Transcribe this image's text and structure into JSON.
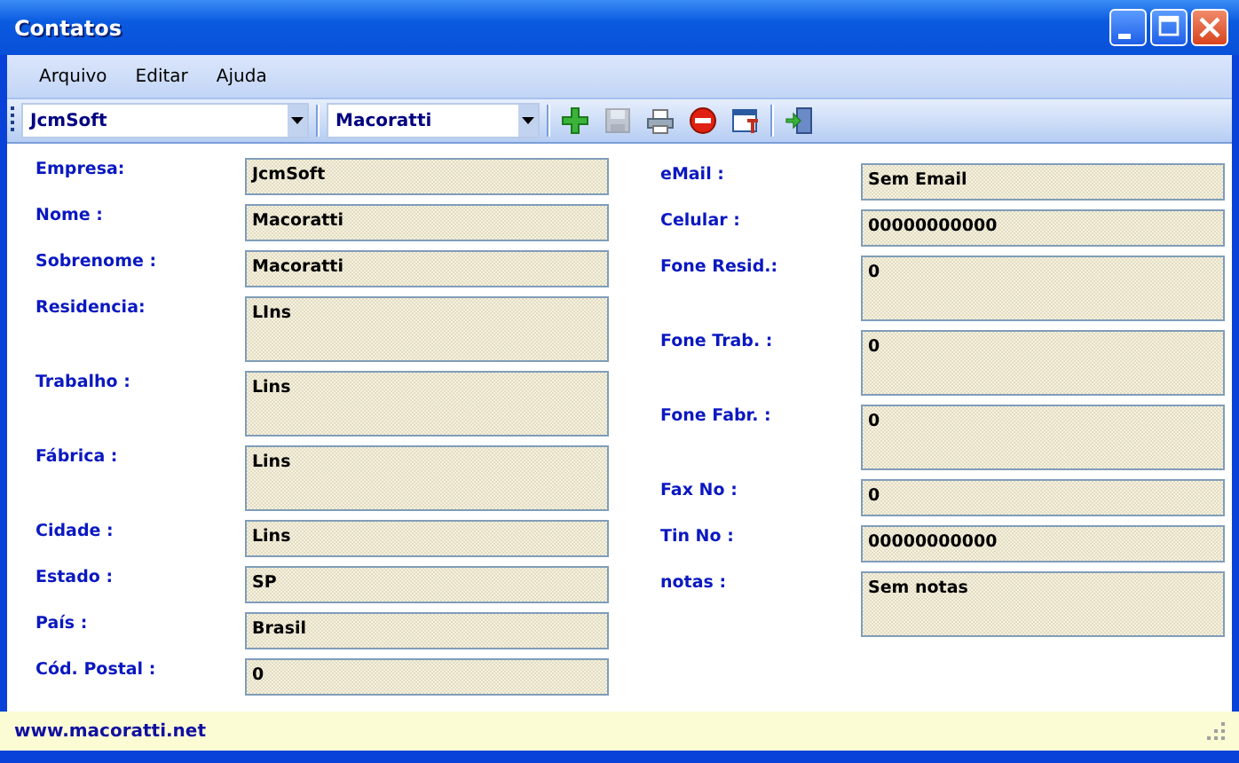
{
  "window": {
    "title": "Contatos"
  },
  "menu": [
    "Arquivo",
    "Editar",
    "Ajuda"
  ],
  "toolbar": {
    "combos": [
      {
        "value": "JcmSoft"
      },
      {
        "value": "Macoratti"
      }
    ],
    "buttons": [
      {
        "kind": "add",
        "disabled": false
      },
      {
        "kind": "save",
        "disabled": true
      },
      {
        "kind": "print",
        "disabled": false
      },
      {
        "kind": "delete",
        "disabled": false
      },
      {
        "kind": "edit",
        "disabled": false
      },
      {
        "kind": "exit",
        "disabled": false
      }
    ]
  },
  "form": {
    "left": [
      {
        "label": "Empresa:",
        "value": "JcmSoft",
        "kind": "single"
      },
      {
        "label": "Nome :",
        "value": "Macoratti",
        "kind": "single"
      },
      {
        "label": "Sobrenome :",
        "value": "Macoratti",
        "kind": "single"
      },
      {
        "label": "Residencia:",
        "value": "LIns",
        "kind": "multi"
      },
      {
        "label": "Trabalho :",
        "value": "Lins",
        "kind": "multi"
      },
      {
        "label": "Fábrica :",
        "value": "Lins",
        "kind": "multi"
      },
      {
        "label": "Cidade :",
        "value": "Lins",
        "kind": "single"
      },
      {
        "label": "Estado :",
        "value": "SP",
        "kind": "single"
      },
      {
        "label": "País :",
        "value": "Brasil",
        "kind": "single"
      },
      {
        "label": "Cód. Postal :",
        "value": "0",
        "kind": "single"
      }
    ],
    "right": [
      {
        "label": "eMail :",
        "value": "Sem Email",
        "kind": "single"
      },
      {
        "label": "Celular :",
        "value": "00000000000",
        "kind": "single"
      },
      {
        "label": "Fone Resid.:",
        "value": "0",
        "kind": "multi"
      },
      {
        "label": "Fone Trab. :",
        "value": "0",
        "kind": "multi"
      },
      {
        "label": "Fone Fabr. :",
        "value": "0",
        "kind": "multi"
      },
      {
        "label": "Fax No :",
        "value": "0",
        "kind": "single"
      },
      {
        "label": "Tin No :",
        "value": "00000000000",
        "kind": "single"
      },
      {
        "label": "notas :",
        "value": "Sem notas",
        "kind": "multi"
      }
    ]
  },
  "status_bar": {
    "text": "www.macoratti.net"
  }
}
